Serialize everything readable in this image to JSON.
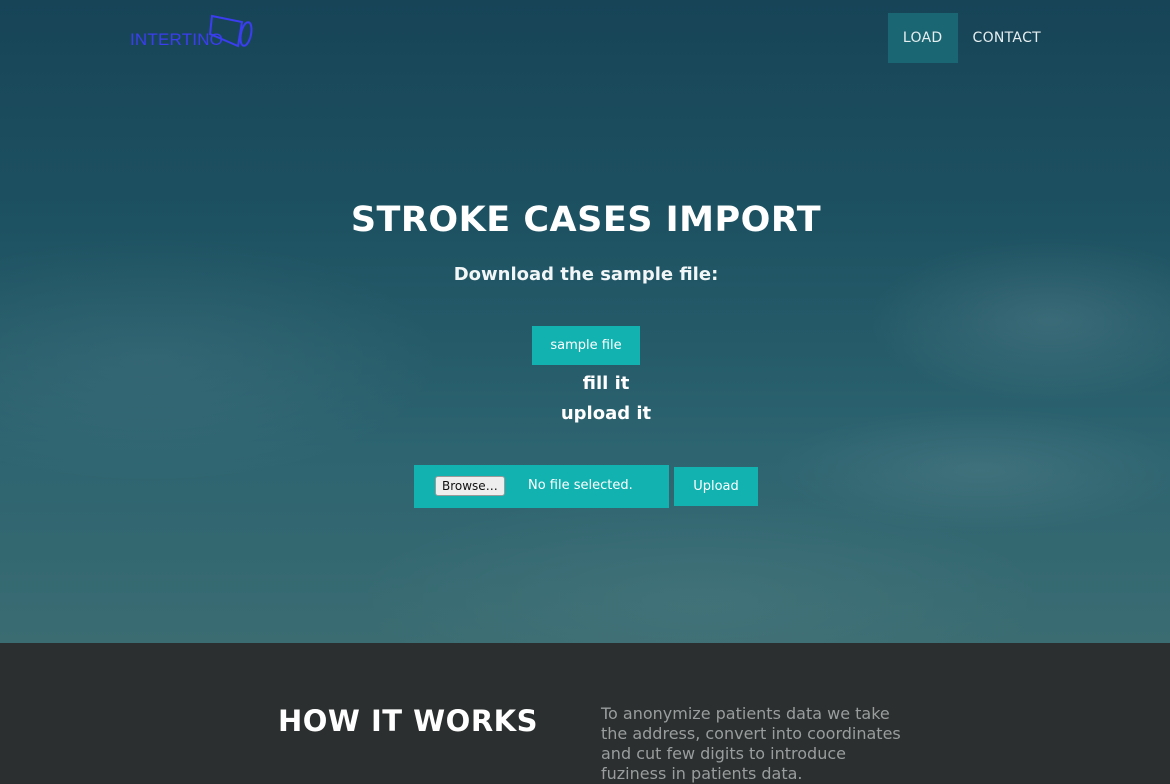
{
  "header": {
    "logo_text": "INTERTINO",
    "nav": [
      {
        "label": "LOAD",
        "active": true
      },
      {
        "label": "CONTACT",
        "active": false
      }
    ]
  },
  "hero": {
    "title": "STROKE CASES IMPORT",
    "subtitle": "Download the sample file:",
    "sample_button": "sample file",
    "step_fill": "fill it",
    "step_upload": "upload it",
    "file_input": {
      "browse_label": "Browse…",
      "status": "No file selected."
    },
    "upload_button": "Upload"
  },
  "how_it_works": {
    "title": "HOW IT WORKS",
    "text": "To anonymize patients data we take the address, convert into coordinates and cut few digits to introduce fuziness in patients data."
  },
  "colors": {
    "accent": "#12b2b0",
    "nav_active": "#1a6673",
    "logo": "#3b3df0",
    "footer_bg": "#2c2f2f"
  }
}
